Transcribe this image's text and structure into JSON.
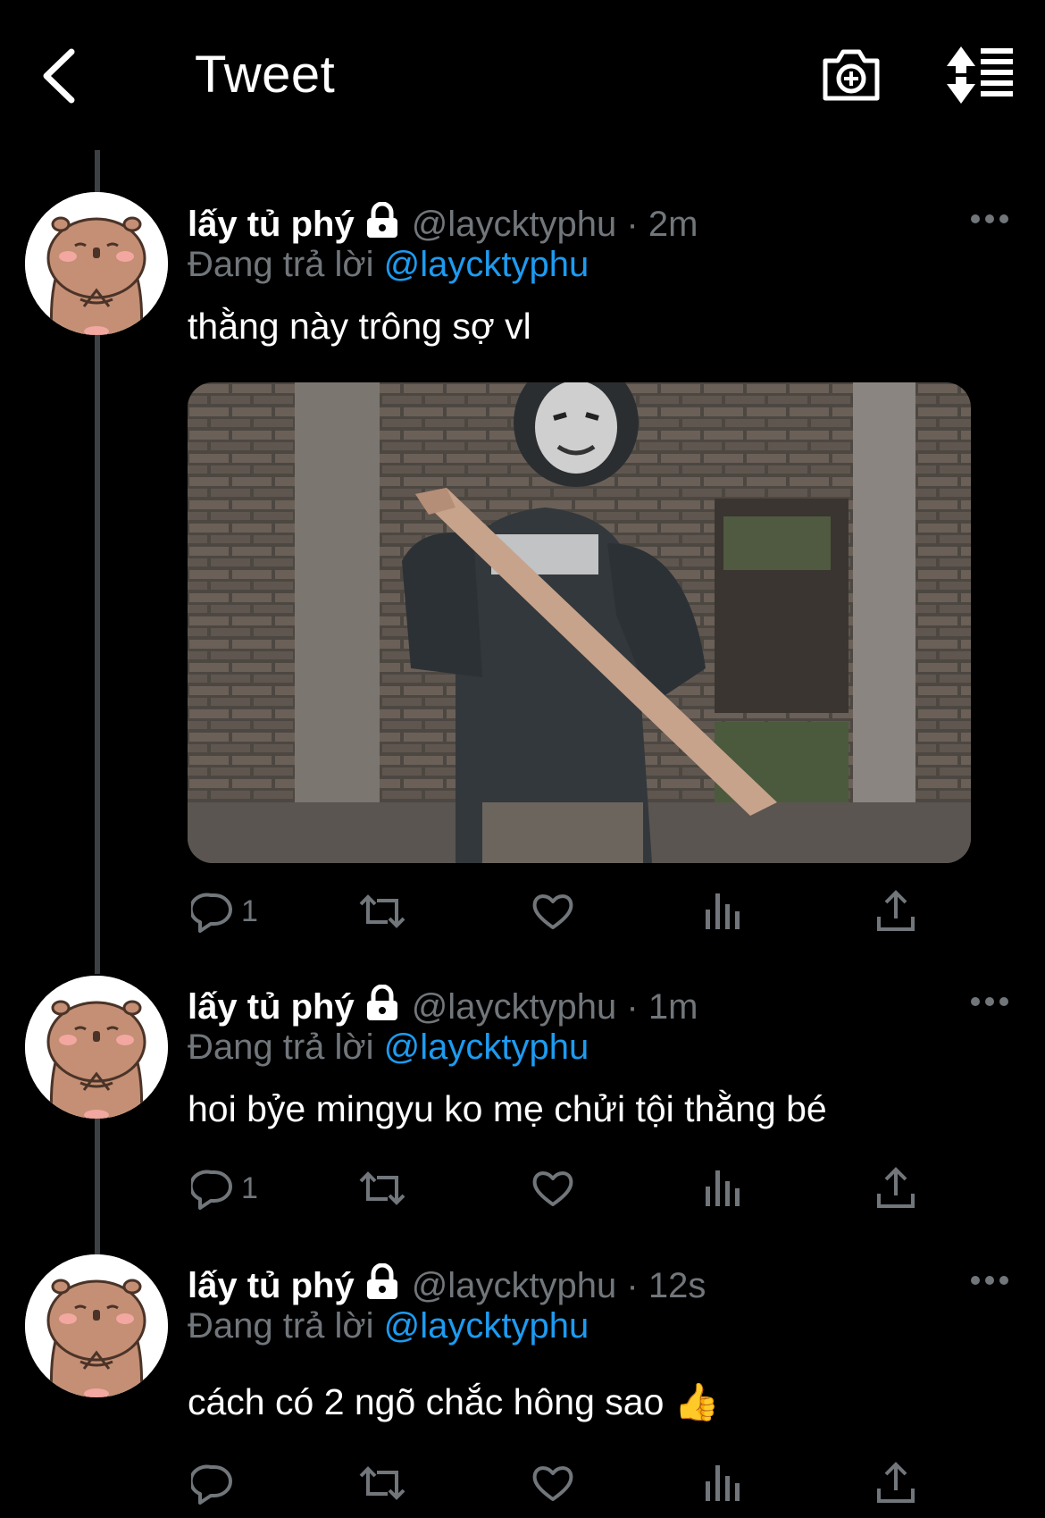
{
  "header": {
    "title": "Tweet",
    "back_icon": "chevron-left-icon",
    "camera_icon": "camera-plus-icon",
    "sort_icon": "sort-icon"
  },
  "colors": {
    "accent": "#1d9bf0",
    "muted": "#71767b",
    "background": "#000000"
  },
  "tweets": [
    {
      "name": "lấy tủ phý",
      "handle": "@laycktyphu",
      "time": "· 2m",
      "reply_prefix": "Đang trả lời",
      "reply_to": "@laycktyphu",
      "text": "thằng này trông sợ vl",
      "reply_count": "1"
    },
    {
      "name": "lấy tủ phý",
      "handle": "@laycktyphu",
      "time": "· 1m",
      "reply_prefix": "Đang trả lời",
      "reply_to": "@laycktyphu",
      "text": "hoi bỷe mingyu ko mẹ chửi tội thằng bé",
      "reply_count": "1"
    },
    {
      "name": "lấy tủ phý",
      "handle": "@laycktyphu",
      "time": "· 12s",
      "reply_prefix": "Đang trả lời",
      "reply_to": "@laycktyphu",
      "text": "cách có 2 ngõ chắc hông sao 👍",
      "reply_count": ""
    }
  ]
}
